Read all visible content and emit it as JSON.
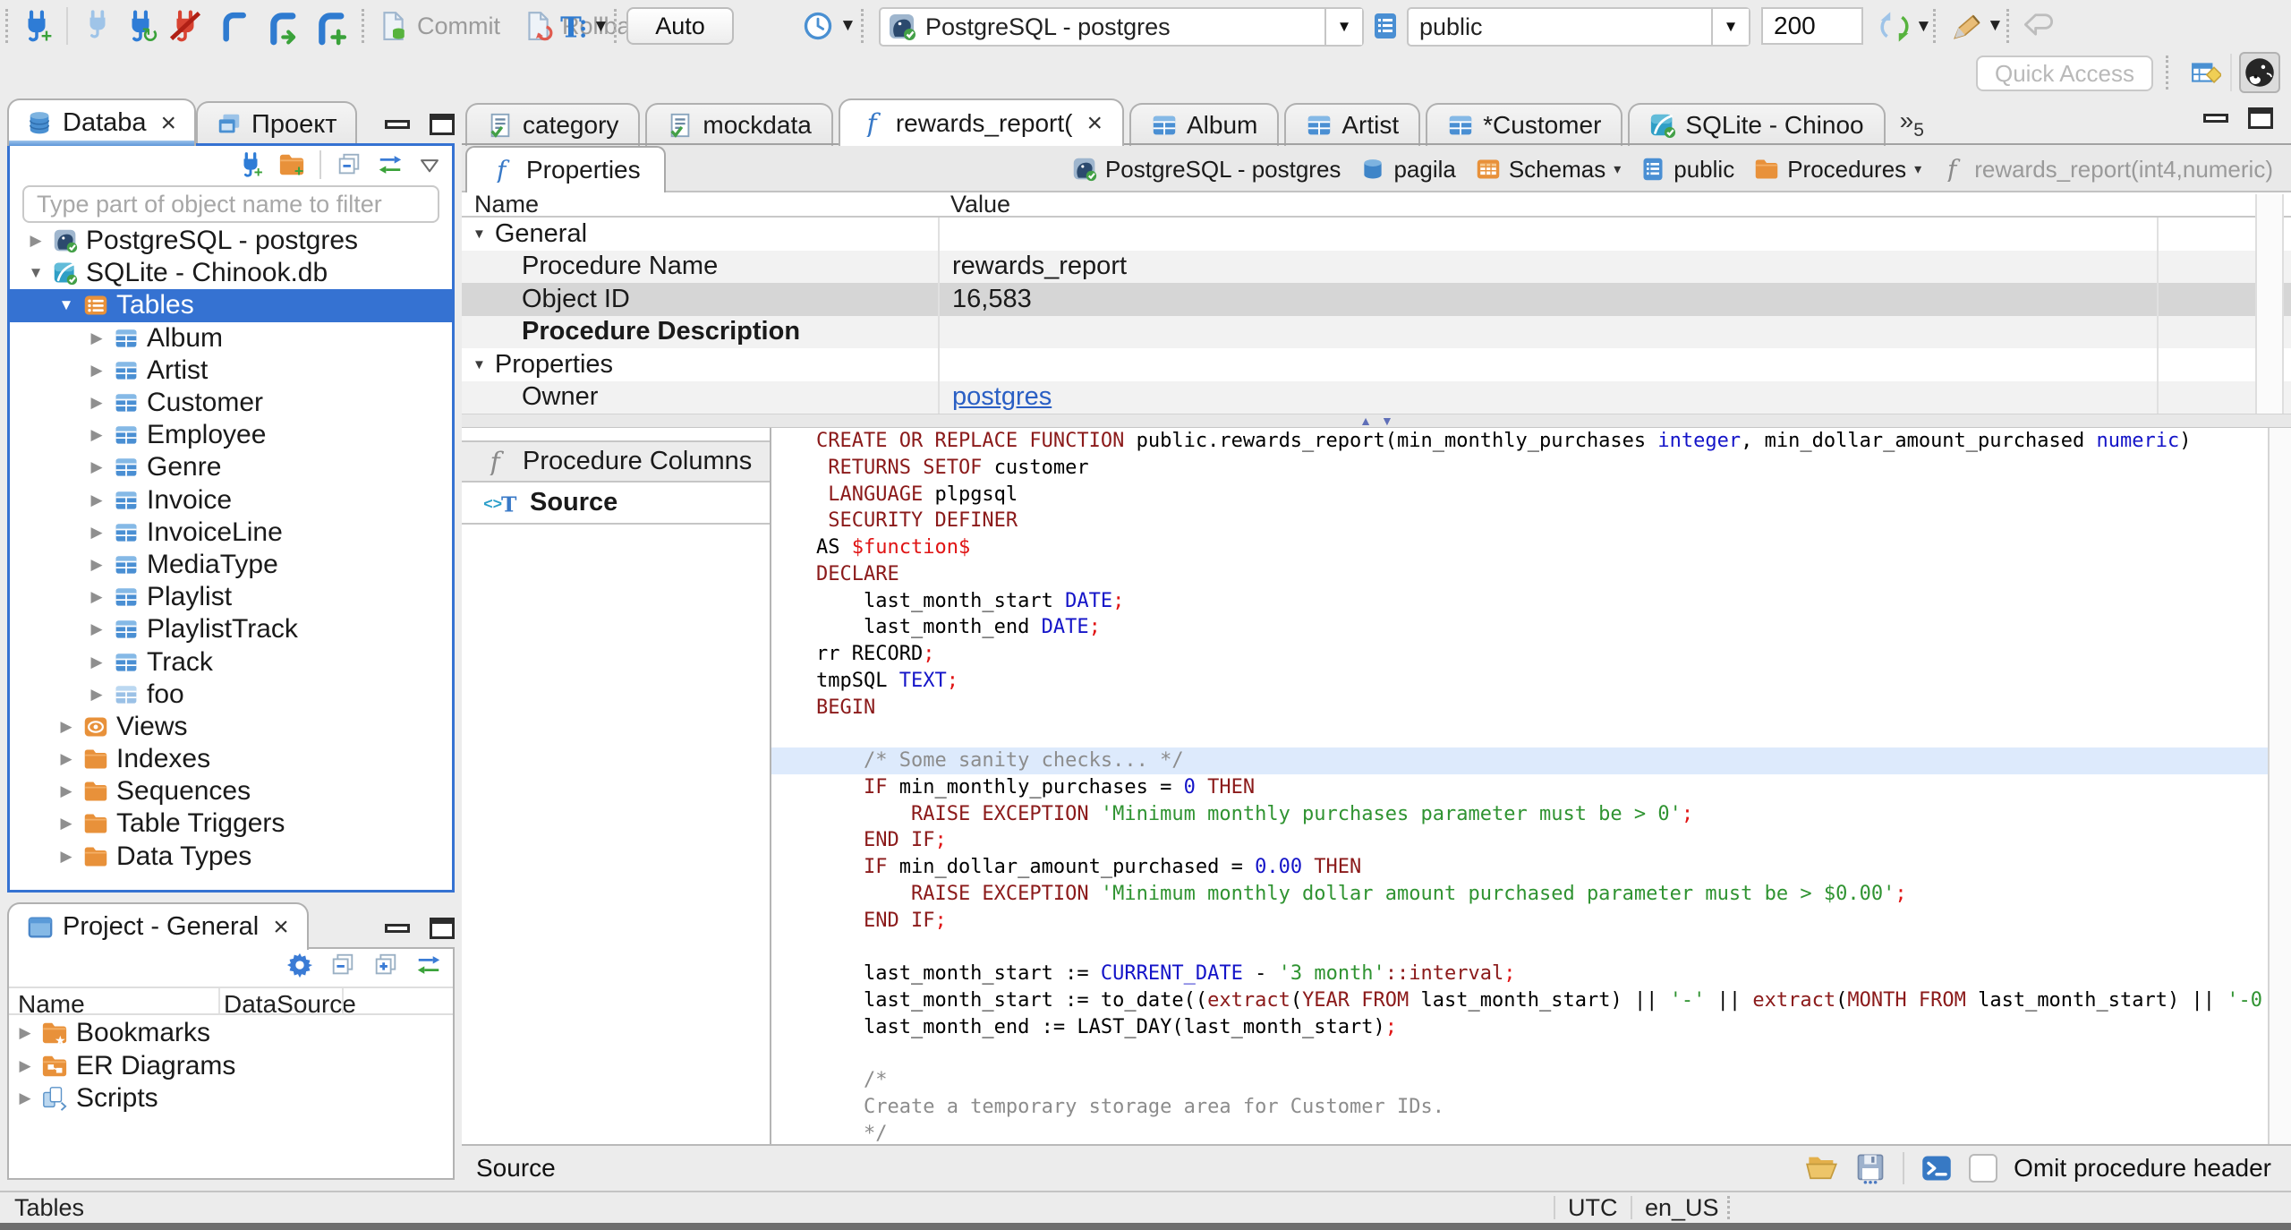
{
  "colors": {
    "accent": "#3572d2",
    "keyword": "#8b1a1a",
    "type": "#1414c8",
    "string": "#2f9331",
    "comment": "#8c8c8c",
    "red": "#e01414",
    "highlight_line": "#ddeafc"
  },
  "toolbar": {
    "commit": "Commit",
    "rollback": "Rollback",
    "auto": "Auto",
    "connection": "PostgreSQL - postgres",
    "schema": "public",
    "fetch_size": "200",
    "quick_access": "Quick Access"
  },
  "sidebar": {
    "tabs": [
      {
        "label": "Databa"
      },
      {
        "label": "Проект"
      }
    ],
    "filter_placeholder": "Type part of object name to filter",
    "tree": [
      {
        "label": "PostgreSQL - postgres",
        "icon": "pg",
        "level": 0,
        "exp": "r"
      },
      {
        "label": "SQLite - Chinook.db",
        "icon": "sqlite",
        "level": 0,
        "exp": "d"
      },
      {
        "label": "Tables",
        "icon": "tables-folder",
        "level": 1,
        "exp": "d",
        "sel": true
      },
      {
        "label": "Album",
        "icon": "table",
        "level": 2,
        "exp": "r"
      },
      {
        "label": "Artist",
        "icon": "table",
        "level": 2,
        "exp": "r"
      },
      {
        "label": "Customer",
        "icon": "table",
        "level": 2,
        "exp": "r"
      },
      {
        "label": "Employee",
        "icon": "table",
        "level": 2,
        "exp": "r"
      },
      {
        "label": "Genre",
        "icon": "table",
        "level": 2,
        "exp": "r"
      },
      {
        "label": "Invoice",
        "icon": "table",
        "level": 2,
        "exp": "r"
      },
      {
        "label": "InvoiceLine",
        "icon": "table",
        "level": 2,
        "exp": "r"
      },
      {
        "label": "MediaType",
        "icon": "table",
        "level": 2,
        "exp": "r"
      },
      {
        "label": "Playlist",
        "icon": "table",
        "level": 2,
        "exp": "r"
      },
      {
        "label": "PlaylistTrack",
        "icon": "table",
        "level": 2,
        "exp": "r"
      },
      {
        "label": "Track",
        "icon": "table",
        "level": 2,
        "exp": "r"
      },
      {
        "label": "foo",
        "icon": "table-light",
        "level": 2,
        "exp": "r"
      },
      {
        "label": "Views",
        "icon": "views",
        "level": 1,
        "exp": "r"
      },
      {
        "label": "Indexes",
        "icon": "folder",
        "level": 1,
        "exp": "r"
      },
      {
        "label": "Sequences",
        "icon": "folder",
        "level": 1,
        "exp": "r"
      },
      {
        "label": "Table Triggers",
        "icon": "folder",
        "level": 1,
        "exp": "r"
      },
      {
        "label": "Data Types",
        "icon": "folder",
        "level": 1,
        "exp": "r"
      }
    ]
  },
  "project": {
    "title": "Project - General",
    "columns": [
      "Name",
      "DataSource"
    ],
    "items": [
      {
        "label": "Bookmarks",
        "icon": "folder-star"
      },
      {
        "label": "ER Diagrams",
        "icon": "folder-er"
      },
      {
        "label": "Scripts",
        "icon": "scripts"
      }
    ]
  },
  "editor": {
    "tabs": [
      {
        "label": "category",
        "icon": "sql-file"
      },
      {
        "label": "mockdata",
        "icon": "sql-file"
      },
      {
        "label": "rewards_report(",
        "icon": "fn-blue",
        "active": true,
        "close": true
      },
      {
        "label": "Album",
        "icon": "table"
      },
      {
        "label": "Artist",
        "icon": "table"
      },
      {
        "label": "*Customer",
        "icon": "table"
      },
      {
        "label": "SQLite - Chinoo",
        "icon": "sqlite"
      }
    ],
    "overflow": "5",
    "properties_tab": "Properties",
    "breadcrumb": [
      {
        "label": "PostgreSQL - postgres",
        "icon": "pg"
      },
      {
        "label": "pagila",
        "icon": "db-cyl"
      },
      {
        "label": "Schemas",
        "icon": "folder-grid",
        "dropdown": true
      },
      {
        "label": "public",
        "icon": "schema-page"
      },
      {
        "label": "Procedures",
        "icon": "folder",
        "dropdown": true
      },
      {
        "label": "rewards_report(int4,numeric)",
        "icon": "fn-gray",
        "muted": true
      }
    ],
    "grid": {
      "columns": [
        "Name",
        "Value"
      ],
      "rows": [
        {
          "type": "group",
          "name": "General"
        },
        {
          "name": "Procedure Name",
          "value": "rewards_report"
        },
        {
          "name": "Object ID",
          "value": "16,583",
          "selected": true
        },
        {
          "name": "Procedure Description",
          "bold": true
        },
        {
          "type": "group",
          "name": "Properties"
        },
        {
          "name": "Owner",
          "value": "postgres",
          "link": true
        }
      ]
    },
    "subtabs": [
      {
        "label": "Procedure Columns",
        "icon": "fn-gray"
      },
      {
        "label": "Source",
        "icon": "source",
        "active": true
      }
    ],
    "bottom": {
      "label": "Source",
      "checkbox_label": "Omit procedure header"
    }
  },
  "code": {
    "lines": [
      {
        "t": [
          [
            "k",
            "CREATE OR REPLACE FUNCTION "
          ],
          [
            "p",
            "public.rewards_report(min_monthly_purchases "
          ],
          [
            "y",
            "integer"
          ],
          [
            "p",
            ", min_dollar_amount_purchased "
          ],
          [
            "y",
            "numeric"
          ],
          [
            "p",
            ")"
          ]
        ]
      },
      {
        "t": [
          [
            "k",
            " RETURNS SETOF "
          ],
          [
            "p",
            "customer"
          ]
        ]
      },
      {
        "t": [
          [
            "k",
            " LANGUAGE "
          ],
          [
            "p",
            "plpgsql"
          ]
        ]
      },
      {
        "t": [
          [
            "k",
            " SECURITY DEFINER"
          ]
        ]
      },
      {
        "t": [
          [
            "p",
            "AS "
          ],
          [
            "r",
            "$function$"
          ]
        ]
      },
      {
        "t": [
          [
            "k",
            "DECLARE"
          ]
        ]
      },
      {
        "t": [
          [
            "p",
            "    last_month_start "
          ],
          [
            "y",
            "DATE"
          ],
          [
            "r",
            ";"
          ]
        ]
      },
      {
        "t": [
          [
            "p",
            "    last_month_end "
          ],
          [
            "y",
            "DATE"
          ],
          [
            "r",
            ";"
          ]
        ]
      },
      {
        "t": [
          [
            "p",
            "rr RECORD"
          ],
          [
            "r",
            ";"
          ]
        ]
      },
      {
        "t": [
          [
            "p",
            "tmpSQL "
          ],
          [
            "y",
            "TEXT"
          ],
          [
            "r",
            ";"
          ]
        ]
      },
      {
        "t": [
          [
            "k",
            "BEGIN"
          ]
        ]
      },
      {
        "t": []
      },
      {
        "hl": true,
        "t": [
          [
            "c",
            "    /* Some sanity checks... */"
          ]
        ]
      },
      {
        "t": [
          [
            "k",
            "    IF "
          ],
          [
            "p",
            "min_monthly_purchases = "
          ],
          [
            "n",
            "0"
          ],
          [
            "k",
            " THEN"
          ]
        ]
      },
      {
        "t": [
          [
            "k",
            "        RAISE EXCEPTION "
          ],
          [
            "s",
            "'Minimum monthly purchases parameter must be > 0'"
          ],
          [
            "r",
            ";"
          ]
        ]
      },
      {
        "t": [
          [
            "k",
            "    END IF"
          ],
          [
            "r",
            ";"
          ]
        ]
      },
      {
        "t": [
          [
            "k",
            "    IF "
          ],
          [
            "p",
            "min_dollar_amount_purchased = "
          ],
          [
            "n",
            "0.00"
          ],
          [
            "k",
            " THEN"
          ]
        ]
      },
      {
        "t": [
          [
            "k",
            "        RAISE EXCEPTION "
          ],
          [
            "s",
            "'Minimum monthly dollar amount purchased parameter must be > $0.00'"
          ],
          [
            "r",
            ";"
          ]
        ]
      },
      {
        "t": [
          [
            "k",
            "    END IF"
          ],
          [
            "r",
            ";"
          ]
        ]
      },
      {
        "t": []
      },
      {
        "t": [
          [
            "p",
            "    last_month_start := "
          ],
          [
            "y",
            "CURRENT_DATE"
          ],
          [
            "p",
            " - "
          ],
          [
            "s",
            "'3 month'"
          ],
          [
            "k",
            "::interval"
          ],
          [
            "r",
            ";"
          ]
        ]
      },
      {
        "t": [
          [
            "p",
            "    last_month_start := to_date(("
          ],
          [
            "k",
            "extract"
          ],
          [
            "p",
            "("
          ],
          [
            "k",
            "YEAR FROM"
          ],
          [
            "p",
            " last_month_start) || "
          ],
          [
            "s",
            "'-'"
          ],
          [
            "p",
            " || "
          ],
          [
            "k",
            "extract"
          ],
          [
            "p",
            "("
          ],
          [
            "k",
            "MONTH FROM"
          ],
          [
            "p",
            " last_month_start) || "
          ],
          [
            "s",
            "'-0"
          ]
        ]
      },
      {
        "t": [
          [
            "p",
            "    last_month_end := LAST_DAY(last_month_start)"
          ],
          [
            "r",
            ";"
          ]
        ]
      },
      {
        "t": []
      },
      {
        "t": [
          [
            "c",
            "    /*"
          ]
        ]
      },
      {
        "t": [
          [
            "c",
            "    Create a temporary storage area for Customer IDs."
          ]
        ]
      },
      {
        "t": [
          [
            "c",
            "    */"
          ]
        ]
      }
    ]
  },
  "status": {
    "left": "Tables",
    "timezone": "UTC",
    "locale": "en_US"
  }
}
